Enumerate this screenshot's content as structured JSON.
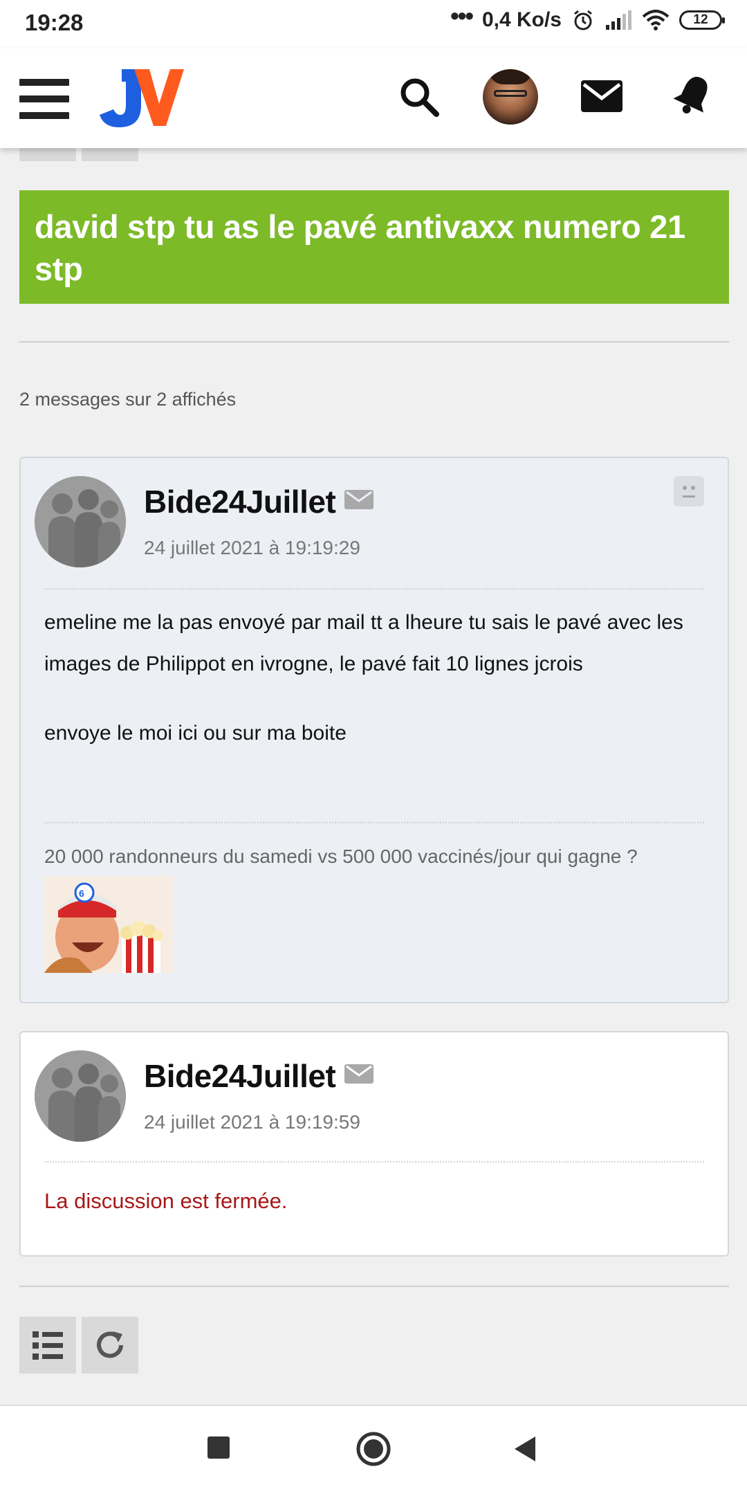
{
  "status_bar": {
    "time": "19:28",
    "network_speed": "0,4 Ko/s",
    "battery": "12"
  },
  "header": {
    "logo_text": "JV",
    "icons": [
      "menu-icon",
      "search-icon",
      "avatar",
      "mail-icon",
      "bell-icon"
    ]
  },
  "topic": {
    "title": "david stp tu as le pavé antivaxx numero 21 stp",
    "count_text": "2 messages sur 2 affichés"
  },
  "posts": [
    {
      "author": "Bide24Juillet",
      "date": "24 juillet 2021 à 19:19:29",
      "paragraphs": [
        "emeline me la pas envoyé par mail tt a lheure tu sais le pavé avec les images de Philippot en ivrogne, le pavé fait 10 lignes jcrois",
        "envoye le moi ici ou sur ma boite"
      ],
      "signature": "20 000 randonneurs du samedi vs 500 000 vaccinés/jour qui gagne ?"
    },
    {
      "author": "Bide24Juillet",
      "date": "24 juillet 2021 à 19:19:59",
      "notice": "La discussion est fermée."
    }
  ],
  "colors": {
    "title_banner": "#7cba28",
    "closed_notice": "#a71818",
    "logo_blue": "#1e5fe0",
    "logo_orange": "#ff5a1e"
  }
}
